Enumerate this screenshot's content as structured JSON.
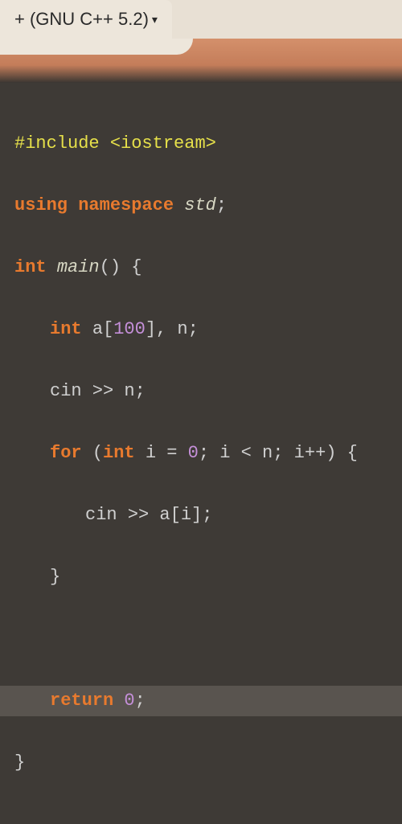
{
  "tab": {
    "label": "+ (GNU C++ 5.2)",
    "dropdown_glyph": "▾"
  },
  "code": {
    "l1_directive": "#include",
    "l1_header": "<iostream>",
    "l2_kw_using": "using",
    "l2_kw_namespace": "namespace",
    "l2_ns": "std",
    "l2_semi": ";",
    "l3_type": "int",
    "l3_func": "main",
    "l3_parens": "()",
    "l3_brace": "{",
    "l4_type": "int",
    "l4_decl": "a[",
    "l4_num": "100",
    "l4_decl2": "], n;",
    "l5_cin": "cin >> n;",
    "l6_for": "for",
    "l6_open": "(",
    "l6_type": "int",
    "l6_init": "i =",
    "l6_zero": "0",
    "l6_cond": "; i < n; i++) {",
    "l7_body": "cin >> a[i];",
    "l8_brace": "}",
    "l10_return": "return",
    "l10_zero": "0",
    "l10_semi": ";",
    "l11_brace": "}"
  }
}
